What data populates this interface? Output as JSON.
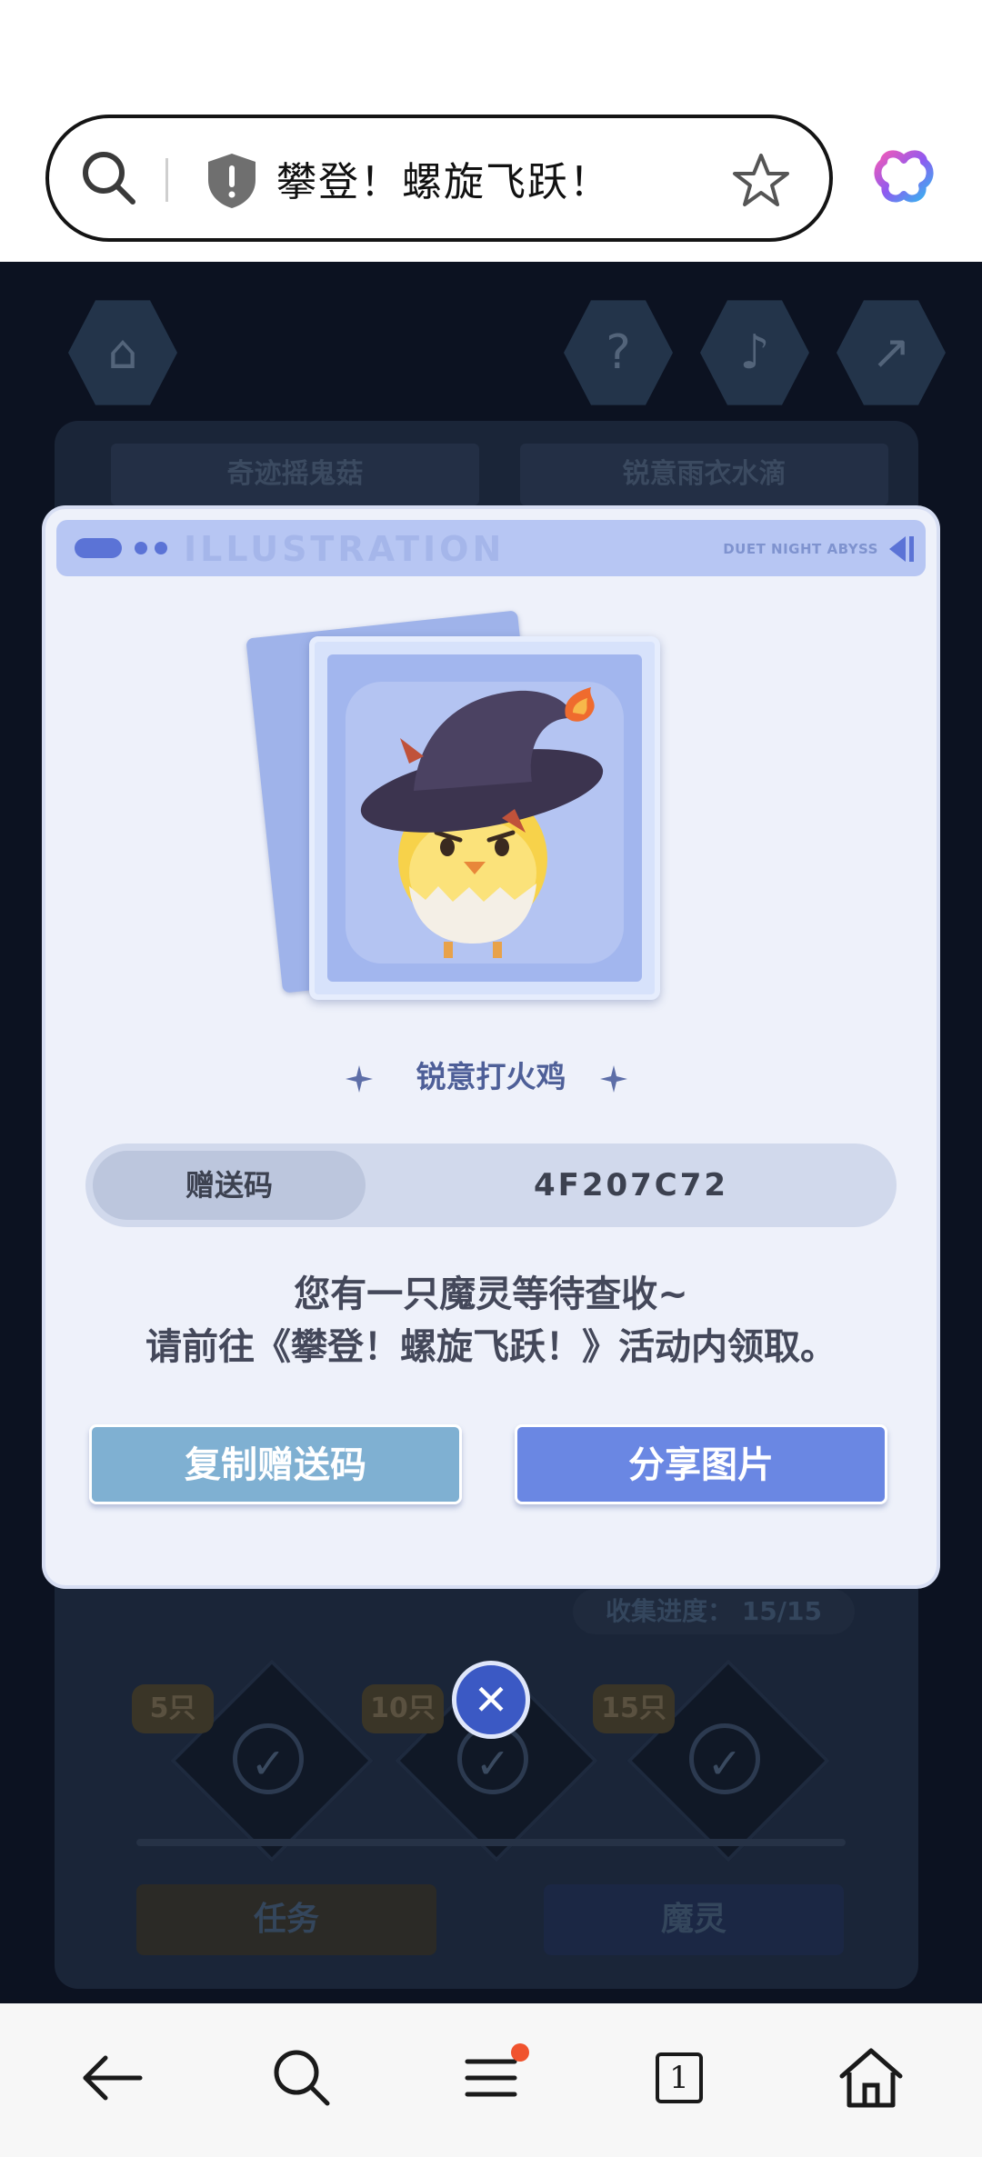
{
  "browser": {
    "address_title": "攀登！螺旋飞跃！",
    "tab_count": "1"
  },
  "scene": {
    "tabs": [
      "奇迹摇鬼菇",
      "锐意雨衣水滴"
    ],
    "progress_text": "收集进度： 15/15",
    "tiers": [
      "5只",
      "10只",
      "15只"
    ],
    "buttons": [
      "任务",
      "魔灵"
    ]
  },
  "modal": {
    "header_decoration": "ILLUSTRATION",
    "header_brand": "DUET NIGHT ABYSS",
    "creature_name": "锐意打火鸡",
    "gift_code_label": "赠送码",
    "gift_code": "4F207C72",
    "message_line1": "您有一只魔灵等待查收~",
    "message_line2": "请前往《攀登！螺旋飞跃！》活动内领取。",
    "copy_button": "复制赠送码",
    "share_button": "分享图片"
  },
  "colors": {
    "modal_bg": "#eef1fa",
    "copy_button": "#7fb0d2",
    "share_button": "#6a87e3",
    "close_button": "#3b59c4",
    "scene_bg": "#0c1221",
    "notification_dot": "#f0532e"
  },
  "icons": [
    "search-icon",
    "shield-icon",
    "star-icon",
    "app-logo-icon",
    "back-icon",
    "menu-icon",
    "tabs-icon",
    "home-icon",
    "close-icon"
  ]
}
